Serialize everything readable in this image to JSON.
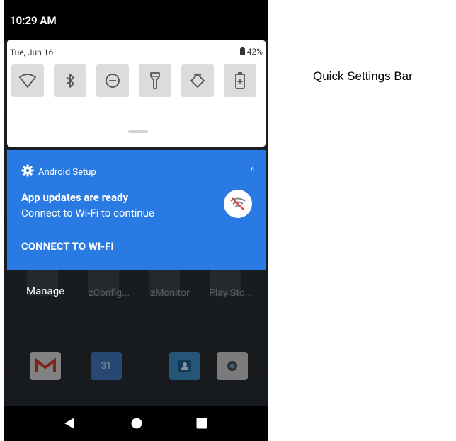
{
  "status_bar": {
    "time": "10:29 AM"
  },
  "quick_settings": {
    "date": "Tue, Jun 16",
    "battery_percent": "42%",
    "tiles": [
      {
        "name": "wifi-tile",
        "icon": "wifi-icon"
      },
      {
        "name": "bluetooth-tile",
        "icon": "bluetooth-icon"
      },
      {
        "name": "do-not-disturb-tile",
        "icon": "do-not-disturb-icon"
      },
      {
        "name": "flashlight-tile",
        "icon": "flashlight-icon"
      },
      {
        "name": "auto-rotate-tile",
        "icon": "auto-rotate-icon"
      },
      {
        "name": "battery-saver-tile",
        "icon": "battery-saver-icon"
      }
    ]
  },
  "notification": {
    "app_name": "Android Setup",
    "title": "App updates are ready",
    "text": "Connect to Wi-Fi to continue",
    "action": "CONNECT TO WI-FI",
    "expand_glyph": "^"
  },
  "manage_label": "Manage",
  "home_apps": [
    {
      "label": "zConfig..."
    },
    {
      "label": "zMonitor"
    },
    {
      "label": "Play Sto..."
    }
  ],
  "callout": {
    "label": "Quick Settings Bar"
  },
  "colors": {
    "notification_bg": "#2a7ae3",
    "status_bar_bg": "#000000",
    "tile_bg": "#dcdcdc"
  }
}
